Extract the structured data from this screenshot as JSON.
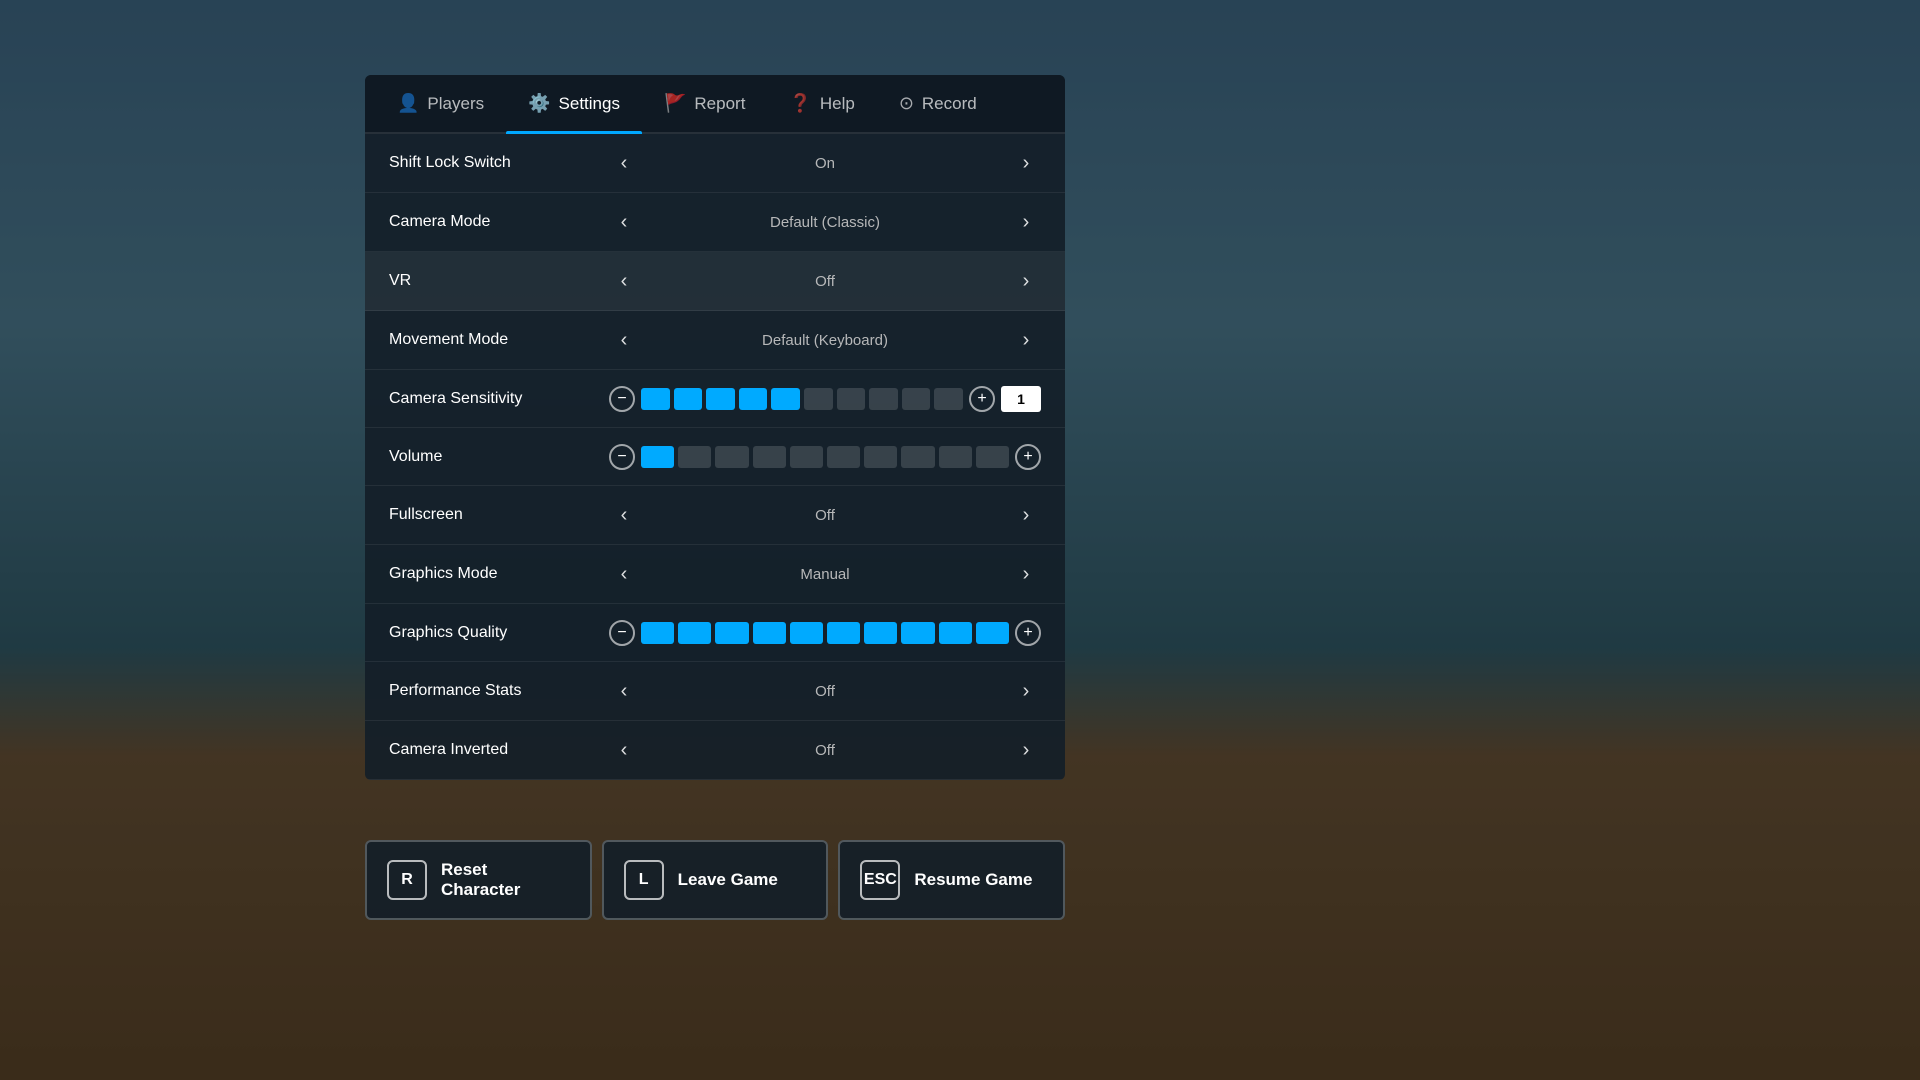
{
  "background": {
    "color": "#3a6a7a"
  },
  "tabs": [
    {
      "id": "players",
      "label": "Players",
      "icon": "👤",
      "active": false
    },
    {
      "id": "settings",
      "label": "Settings",
      "icon": "⚙️",
      "active": true
    },
    {
      "id": "report",
      "label": "Report",
      "icon": "🚩",
      "active": false
    },
    {
      "id": "help",
      "label": "Help",
      "icon": "❓",
      "active": false
    },
    {
      "id": "record",
      "label": "Record",
      "icon": "⊙",
      "active": false
    }
  ],
  "settings": [
    {
      "id": "shift-lock",
      "label": "Shift Lock Switch",
      "type": "toggle",
      "value": "On",
      "highlighted": false
    },
    {
      "id": "camera-mode",
      "label": "Camera Mode",
      "type": "toggle",
      "value": "Default (Classic)",
      "highlighted": false
    },
    {
      "id": "vr",
      "label": "VR",
      "type": "toggle",
      "value": "Off",
      "highlighted": true
    },
    {
      "id": "movement-mode",
      "label": "Movement Mode",
      "type": "toggle",
      "value": "Default (Keyboard)",
      "highlighted": false
    },
    {
      "id": "camera-sensitivity",
      "label": "Camera Sensitivity",
      "type": "slider",
      "activeSegments": 5,
      "totalSegments": 10,
      "numericValue": "1",
      "hasValueInput": true
    },
    {
      "id": "volume",
      "label": "Volume",
      "type": "slider",
      "activeSegments": 1,
      "totalSegments": 10,
      "numericValue": null,
      "hasValueInput": false
    },
    {
      "id": "fullscreen",
      "label": "Fullscreen",
      "type": "toggle",
      "value": "Off",
      "highlighted": false
    },
    {
      "id": "graphics-mode",
      "label": "Graphics Mode",
      "type": "toggle",
      "value": "Manual",
      "highlighted": false
    },
    {
      "id": "graphics-quality",
      "label": "Graphics Quality",
      "type": "slider",
      "activeSegments": 10,
      "totalSegments": 10,
      "numericValue": null,
      "hasValueInput": false
    },
    {
      "id": "performance-stats",
      "label": "Performance Stats",
      "type": "toggle",
      "value": "Off",
      "highlighted": false
    },
    {
      "id": "camera-inverted",
      "label": "Camera Inverted",
      "type": "toggle",
      "value": "Off",
      "highlighted": false
    }
  ],
  "buttons": [
    {
      "id": "reset",
      "key": "R",
      "label": "Reset Character"
    },
    {
      "id": "leave",
      "key": "L",
      "label": "Leave Game"
    },
    {
      "id": "resume",
      "key": "ESC",
      "label": "Resume Game"
    }
  ]
}
